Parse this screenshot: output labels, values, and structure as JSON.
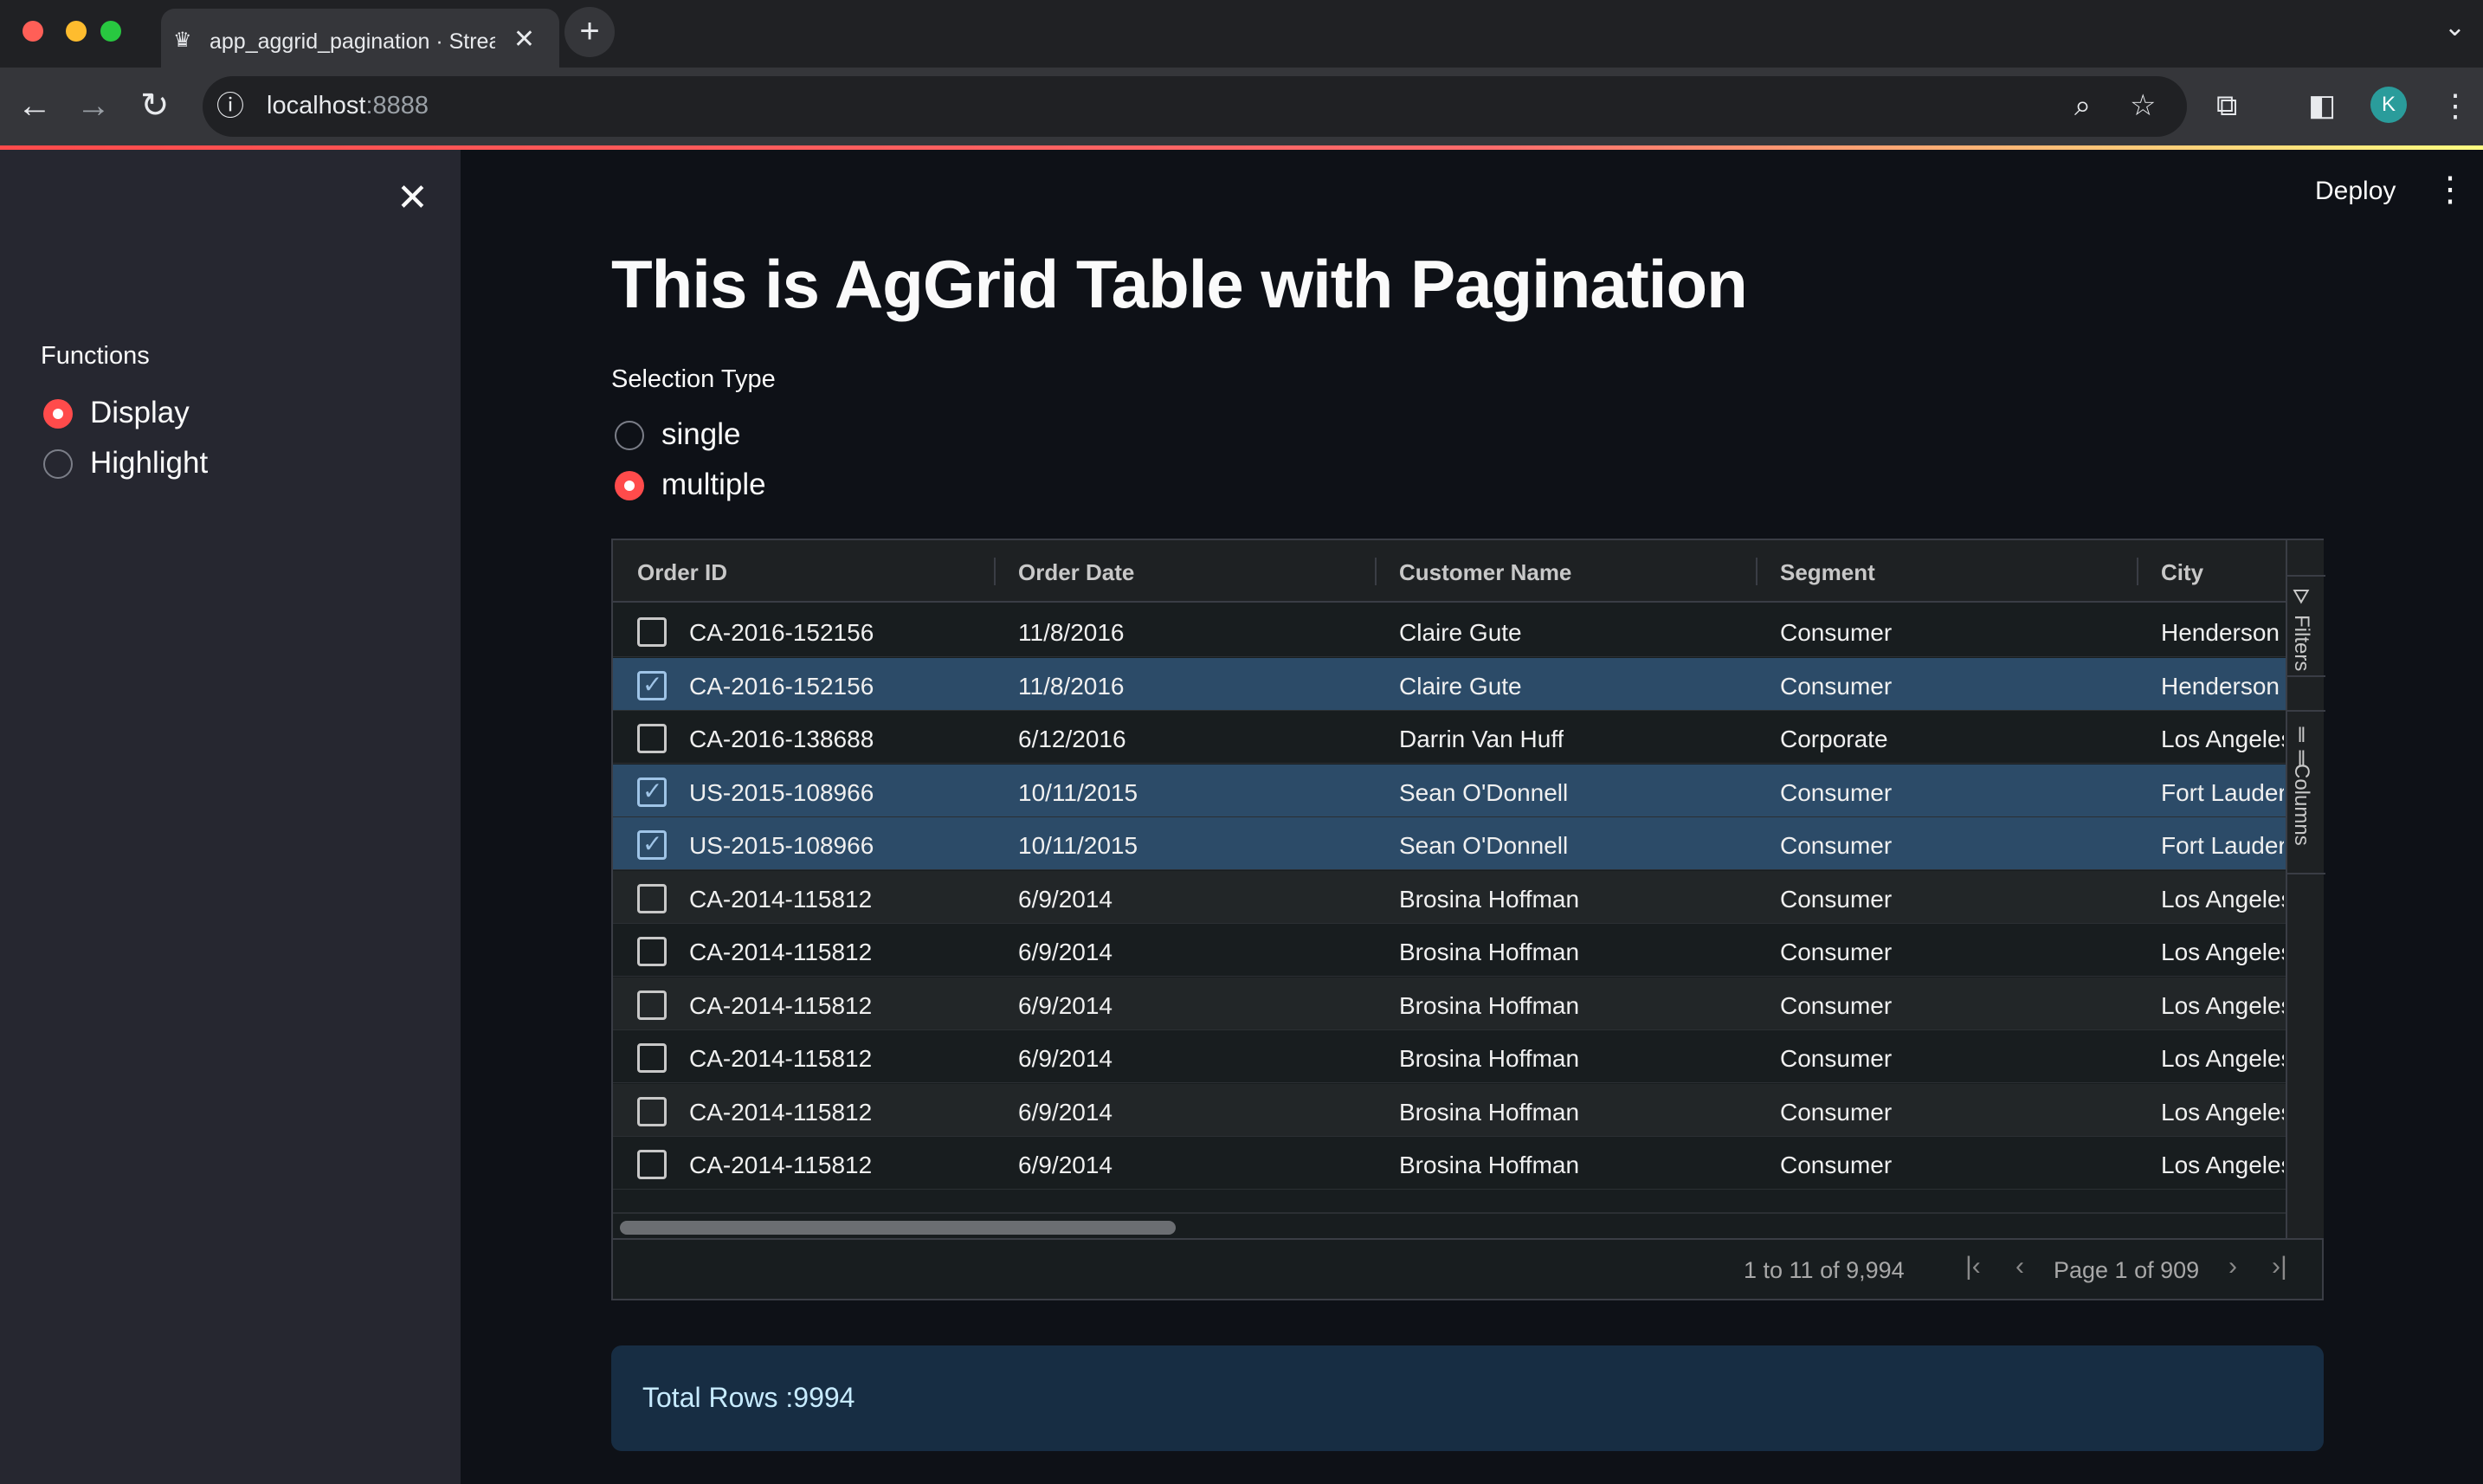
{
  "browser": {
    "tab_title": "app_aggrid_pagination · Streamlit",
    "url_host": "localhost",
    "url_port": ":8888",
    "avatar_letter": "K"
  },
  "sidebar": {
    "section_label": "Functions",
    "options": [
      {
        "label": "Display",
        "selected": true
      },
      {
        "label": "Highlight",
        "selected": false
      }
    ]
  },
  "header": {
    "deploy_label": "Deploy"
  },
  "main": {
    "title": "This is AgGrid Table with Pagination",
    "selection_type_label": "Selection Type",
    "selection_options": [
      {
        "label": "single",
        "selected": false
      },
      {
        "label": "multiple",
        "selected": true
      }
    ]
  },
  "grid": {
    "columns": [
      "Order ID",
      "Order Date",
      "Customer Name",
      "Segment",
      "City"
    ],
    "rows": [
      {
        "checked": false,
        "order_id": "CA-2016-152156",
        "order_date": "11/8/2016",
        "customer": "Claire Gute",
        "segment": "Consumer",
        "city": "Henderson"
      },
      {
        "checked": true,
        "order_id": "CA-2016-152156",
        "order_date": "11/8/2016",
        "customer": "Claire Gute",
        "segment": "Consumer",
        "city": "Henderson"
      },
      {
        "checked": false,
        "order_id": "CA-2016-138688",
        "order_date": "6/12/2016",
        "customer": "Darrin Van Huff",
        "segment": "Corporate",
        "city": "Los Angeles"
      },
      {
        "checked": true,
        "order_id": "US-2015-108966",
        "order_date": "10/11/2015",
        "customer": "Sean O'Donnell",
        "segment": "Consumer",
        "city": "Fort Lauderdale"
      },
      {
        "checked": true,
        "order_id": "US-2015-108966",
        "order_date": "10/11/2015",
        "customer": "Sean O'Donnell",
        "segment": "Consumer",
        "city": "Fort Lauderdale"
      },
      {
        "checked": false,
        "order_id": "CA-2014-115812",
        "order_date": "6/9/2014",
        "customer": "Brosina Hoffman",
        "segment": "Consumer",
        "city": "Los Angeles"
      },
      {
        "checked": false,
        "order_id": "CA-2014-115812",
        "order_date": "6/9/2014",
        "customer": "Brosina Hoffman",
        "segment": "Consumer",
        "city": "Los Angeles"
      },
      {
        "checked": false,
        "order_id": "CA-2014-115812",
        "order_date": "6/9/2014",
        "customer": "Brosina Hoffman",
        "segment": "Consumer",
        "city": "Los Angeles"
      },
      {
        "checked": false,
        "order_id": "CA-2014-115812",
        "order_date": "6/9/2014",
        "customer": "Brosina Hoffman",
        "segment": "Consumer",
        "city": "Los Angeles"
      },
      {
        "checked": false,
        "order_id": "CA-2014-115812",
        "order_date": "6/9/2014",
        "customer": "Brosina Hoffman",
        "segment": "Consumer",
        "city": "Los Angeles"
      },
      {
        "checked": false,
        "order_id": "CA-2014-115812",
        "order_date": "6/9/2014",
        "customer": "Brosina Hoffman",
        "segment": "Consumer",
        "city": "Los Angeles"
      }
    ],
    "side_tabs": [
      "Filters",
      "Columns"
    ],
    "paging_summary": "1 to 11 of 9,994",
    "paging_pages": "Page 1 of 909"
  },
  "info": {
    "text": "Total Rows :9994"
  },
  "colors": {
    "accent": "#ff4b4b",
    "selected_row": "#2c4b68",
    "info_bg": "#172d43"
  }
}
